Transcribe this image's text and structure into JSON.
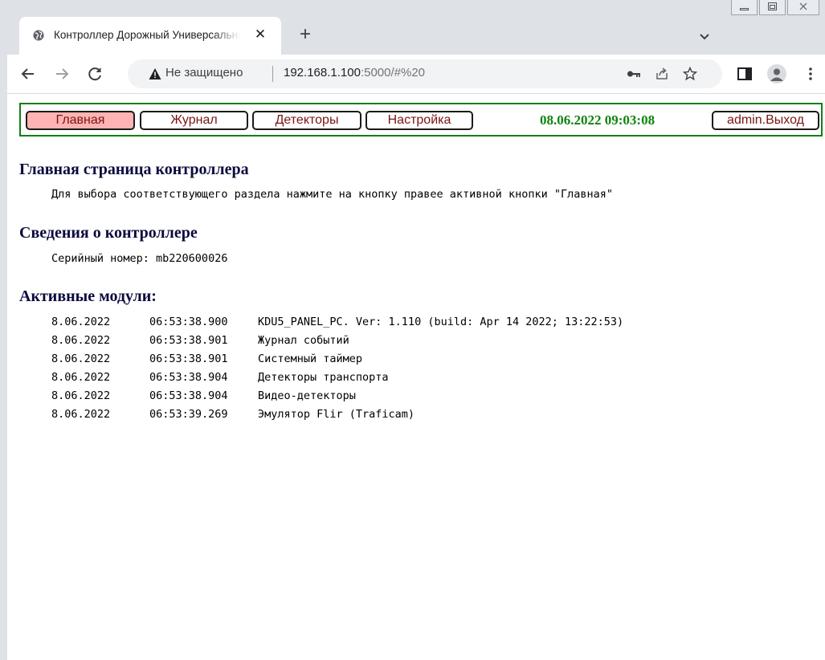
{
  "browser": {
    "tab_title": "Контроллер Дорожный Универсальный",
    "tab_close": "✕",
    "new_tab": "+",
    "security_label": "Не защищено",
    "url_host": "192.168.1.100",
    "url_rest": ":5000/#%20",
    "icons": [
      "globe-icon",
      "close-icon",
      "plus-icon",
      "tab-search-icon",
      "back-icon",
      "forward-icon",
      "reload-icon",
      "warning-icon",
      "key-icon",
      "share-icon",
      "star-icon",
      "sidebar-icon",
      "profile-icon",
      "menu-icon",
      "minimize-icon",
      "maximize-icon",
      "window-close-icon"
    ]
  },
  "colors": {
    "nav_border": "#108010",
    "button_text": "#7a1414",
    "active_button_bg": "#ffb3b3",
    "datetime": "#0d850d",
    "heading": "#0a0a3e"
  },
  "nav": {
    "main": "Главная",
    "journal": "Журнал",
    "detectors": "Детекторы",
    "settings": "Настройка",
    "datetime": "08.06.2022 09:03:08",
    "logout": "admin.Выход"
  },
  "main": {
    "title": "Главная страница контроллера",
    "hint": "Для выбора соответствующего раздела нажмите на кнопку правее активной кнопки \"Главная\""
  },
  "info": {
    "title": "Сведения о контроллере",
    "serial": "Серийный номер: mb220600026"
  },
  "modules": {
    "title": "Активные модули:",
    "rows": [
      {
        "date": "8.06.2022",
        "time": "06:53:38.900",
        "text": "KDU5_PANEL_PC. Ver: 1.110 (build: Apr 14 2022; 13:22:53)"
      },
      {
        "date": "8.06.2022",
        "time": "06:53:38.901",
        "text": "Журнал событий"
      },
      {
        "date": "8.06.2022",
        "time": "06:53:38.901",
        "text": "Системный таймер"
      },
      {
        "date": "8.06.2022",
        "time": "06:53:38.904",
        "text": "Детекторы транспорта"
      },
      {
        "date": "8.06.2022",
        "time": "06:53:38.904",
        "text": "Видео-детекторы"
      },
      {
        "date": "8.06.2022",
        "time": "06:53:39.269",
        "text": "Эмулятор Flir (Traficam)"
      }
    ]
  }
}
